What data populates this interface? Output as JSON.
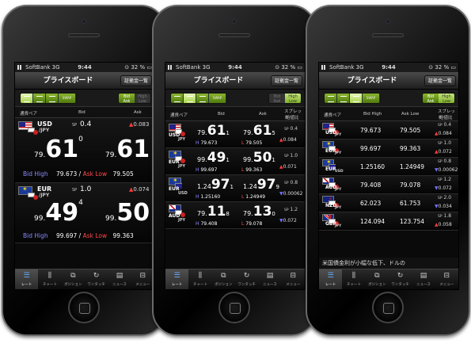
{
  "status": {
    "carrier": "SoftBank",
    "network": "3G",
    "time": "9:44",
    "battery": "32 %"
  },
  "nav": {
    "title": "プライスボード",
    "button": "証拠金一覧"
  },
  "toolbar": {
    "swap": "SWAP",
    "bid": "Bid",
    "ask": "Ask",
    "high": "High",
    "low": "Low"
  },
  "tabs": [
    "レート",
    "チャート",
    "ポジション",
    "ワンタッチ",
    "ニュース",
    "メニュー"
  ],
  "screen1": {
    "head": {
      "pair": "通貨ペア",
      "bid": "Bid",
      "ask": "Ask"
    },
    "rows": [
      {
        "base": "USD",
        "quote": "/JPY",
        "sp_label": "SP",
        "sp": "0.4",
        "change": "0.083",
        "bid_pre": "79.",
        "bid_big": "61",
        "bid_post": "0",
        "ask_pre": "79.",
        "ask_big": "61",
        "ask_post": "",
        "bid_high_label": "Bid High",
        "bid_high": "79.673",
        "slash": "/",
        "ask_low_label": "Ask Low",
        "ask_low": "79.505"
      },
      {
        "base": "EUR",
        "quote": "/JPY",
        "sp_label": "SP",
        "sp": "1.0",
        "change": "0.074",
        "bid_pre": "99.",
        "bid_big": "49",
        "bid_post": "4",
        "ask_pre": "99.",
        "ask_big": "50",
        "ask_post": "",
        "bid_high_label": "Bid High",
        "bid_high": "99.697",
        "slash": "/",
        "ask_low_label": "Ask Low",
        "ask_low": "99.363"
      }
    ]
  },
  "screen2": {
    "head": {
      "pair": "通貨ペア",
      "bid": "Bid",
      "ask": "Ask",
      "spread": "スプレッド",
      "change_label": "始値比"
    },
    "rows": [
      {
        "base": "USD",
        "quote": "JPY",
        "bid_pre": "79.",
        "bid_big": "61",
        "bid_post": "1",
        "ask_pre": "79.",
        "ask_big": "61",
        "ask_post": "5",
        "h": "H",
        "high": "79.673",
        "l": "L",
        "low": "79.505",
        "sp_label": "SP",
        "sp": "0.4",
        "change": "0.084",
        "dir": "up"
      },
      {
        "base": "EUR",
        "quote": "JPY",
        "bid_pre": "99.",
        "bid_big": "49",
        "bid_post": "1",
        "ask_pre": "99.",
        "ask_big": "50",
        "ask_post": "1",
        "h": "H",
        "high": "99.697",
        "l": "L",
        "low": "99.363",
        "sp_label": "SP",
        "sp": "1.0",
        "change": "0.071",
        "dir": "up"
      },
      {
        "base": "EUR",
        "quote": "USD",
        "bid_pre": "1.24",
        "bid_big": "97",
        "bid_post": "1",
        "ask_pre": "1.24",
        "ask_big": "97",
        "ask_post": "9",
        "h": "H",
        "high": "1.25160",
        "l": "L",
        "low": "1.24949",
        "sp_label": "SP",
        "sp": "0.8",
        "change": "0.00062",
        "dir": "down"
      },
      {
        "base": "AUD",
        "quote": "JPY",
        "bid_pre": "79.",
        "bid_big": "11",
        "bid_post": "8",
        "ask_pre": "79.",
        "ask_big": "13",
        "ask_post": "0",
        "h": "H",
        "high": "79.408",
        "l": "L",
        "low": "79.078",
        "sp_label": "SP",
        "sp": "1.2",
        "change": "0.072",
        "dir": "down"
      }
    ]
  },
  "screen3": {
    "head": {
      "pair": "通貨ペア",
      "bid_high": "Bid High",
      "ask_low": "Ask Low",
      "spread": "スプレッド",
      "change_label": "始値比"
    },
    "rows": [
      {
        "base": "USD",
        "quote": "JPY",
        "bid_high": "79.673",
        "ask_low": "79.505",
        "sp_label": "SP",
        "sp": "0.4",
        "change": "0.084",
        "dir": "up"
      },
      {
        "base": "EUR",
        "quote": "JPY",
        "bid_high": "99.697",
        "ask_low": "99.363",
        "sp_label": "SP",
        "sp": "1.0",
        "change": "0.072",
        "dir": "up"
      },
      {
        "base": "EUR",
        "quote": "USD",
        "bid_high": "1.25160",
        "ask_low": "1.24949",
        "sp_label": "SP",
        "sp": "0.8",
        "change": "0.00062",
        "dir": "down"
      },
      {
        "base": "AUD",
        "quote": "JPY",
        "bid_high": "79.408",
        "ask_low": "79.078",
        "sp_label": "SP",
        "sp": "1.2",
        "change": "0.072",
        "dir": "down"
      },
      {
        "base": "NZD",
        "quote": "JPY",
        "bid_high": "62.023",
        "ask_low": "61.753",
        "sp_label": "SP",
        "sp": "2.0",
        "change": "0.034",
        "dir": "down"
      },
      {
        "base": "GBP",
        "quote": "JPY",
        "bid_high": "124.094",
        "ask_low": "123.754",
        "sp_label": "SP",
        "sp": "1.8",
        "change": "0.058",
        "dir": "up"
      }
    ],
    "ticker": "米国債金利が小幅な低下、ドルの"
  }
}
